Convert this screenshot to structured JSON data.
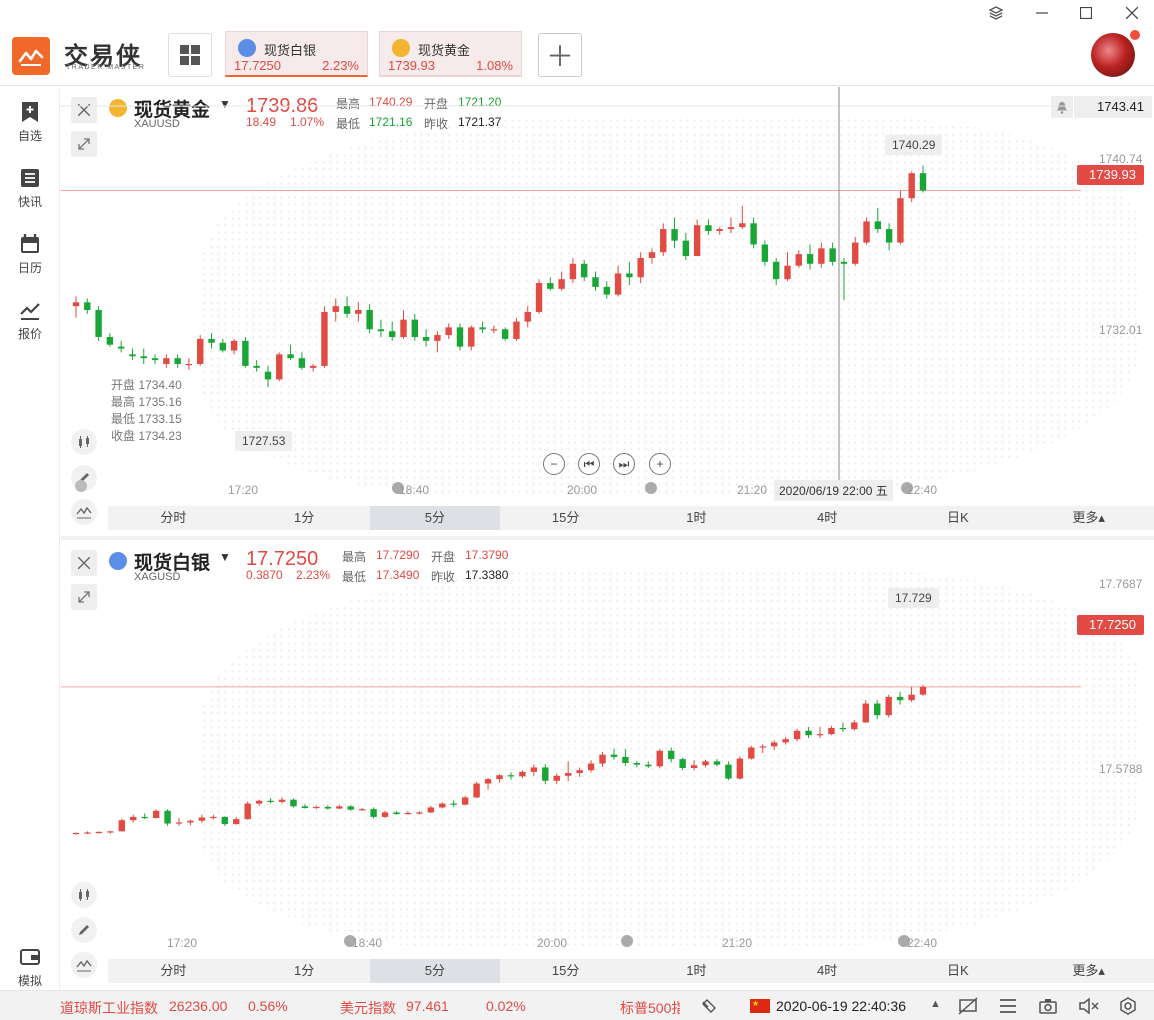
{
  "app": {
    "name": "交易侠",
    "subtitle": "TRADER MASTER"
  },
  "tickers": [
    {
      "name": "现货白银",
      "price": "17.7250",
      "change": "2.23%",
      "icon_color": "#5b8ee6"
    },
    {
      "name": "现货黄金",
      "price": "1739.93",
      "change": "1.08%",
      "icon_color": "#f2b431"
    }
  ],
  "sidebar": [
    {
      "label": "自选",
      "icon": "bookmark-plus-icon"
    },
    {
      "label": "快讯",
      "icon": "news-list-icon"
    },
    {
      "label": "日历",
      "icon": "calendar-icon"
    },
    {
      "label": "报价",
      "icon": "chart-line-icon"
    },
    {
      "label": "模拟",
      "icon": "wallet-icon"
    }
  ],
  "gold": {
    "name": "现货黄金",
    "code": "XAUUSD",
    "price": "1739.86",
    "change": "18.49",
    "pct": "1.07%",
    "high_label": "最高",
    "high": "1740.29",
    "open_label": "开盘",
    "open": "1721.20",
    "low_label": "最低",
    "low": "1721.16",
    "prev_label": "昨收",
    "prev": "1721.37",
    "alert_price": "1743.41",
    "current_tag": "1739.93",
    "peak_tip": "1740.29",
    "low_tip": "1727.53",
    "y_ticks": [
      "1740.74",
      "1732.01"
    ],
    "x_ticks": [
      "17:20",
      "18:40",
      "20:00",
      "21:20",
      "22:40"
    ],
    "crosshair_time": "2020/06/19 22:00 五",
    "ohlc": {
      "o_label": "开盘",
      "o": "1734.40",
      "h_label": "最高",
      "h": "1735.16",
      "l_label": "最低",
      "l": "1733.15",
      "c_label": "收盘",
      "c": "1734.23"
    }
  },
  "silver": {
    "name": "现货白银",
    "code": "XAGUSD",
    "price": "17.7250",
    "change": "0.3870",
    "pct": "2.23%",
    "high_label": "最高",
    "high": "17.7290",
    "open_label": "开盘",
    "open": "17.3790",
    "low_label": "最低",
    "low": "17.3490",
    "prev_label": "昨收",
    "prev": "17.3380",
    "current_tag": "17.7250",
    "peak_tip": "17.729",
    "y_ticks": [
      "17.7687",
      "17.5788"
    ],
    "x_ticks": [
      "17:20",
      "18:40",
      "20:00",
      "21:20",
      "22:40"
    ]
  },
  "timeframes": [
    "分时",
    "1分",
    "5分",
    "15分",
    "1时",
    "4时",
    "日K",
    "更多▴"
  ],
  "selected_timeframe": "5分",
  "status": {
    "dow_name": "道琼斯工业指数",
    "dow_val": "26236.00",
    "dow_pct": "0.56%",
    "usd_name": "美元指数",
    "usd_val": "97.461",
    "usd_pct": "0.02%",
    "sp_name": "标普500指",
    "datetime": "2020-06-19 22:40:36"
  },
  "colors": {
    "up": "#e24a44",
    "down": "#1aa537",
    "accent": "#f0682a"
  },
  "chart_data": [
    {
      "type": "candlestick",
      "title": "现货黄金 XAUUSD",
      "x_ticks": [
        "17:20",
        "18:40",
        "20:00",
        "21:20",
        "22:40"
      ],
      "candles": [
        [
          1733.0,
          1733.5,
          1732.4,
          1733.2
        ],
        [
          1733.2,
          1733.4,
          1732.6,
          1732.8
        ],
        [
          1732.8,
          1733.0,
          1731.2,
          1731.4
        ],
        [
          1731.4,
          1731.6,
          1730.9,
          1731.0
        ],
        [
          1730.9,
          1731.2,
          1730.6,
          1730.8
        ],
        [
          1730.5,
          1730.8,
          1730.2,
          1730.4
        ],
        [
          1730.4,
          1730.8,
          1730.0,
          1730.3
        ],
        [
          1730.3,
          1730.5,
          1730.0,
          1730.2
        ],
        [
          1730.0,
          1730.5,
          1729.8,
          1730.3
        ],
        [
          1730.3,
          1730.5,
          1729.8,
          1730.0
        ],
        [
          1730.0,
          1730.3,
          1729.7,
          1730.0
        ],
        [
          1730.0,
          1731.5,
          1729.9,
          1731.3
        ],
        [
          1731.3,
          1731.6,
          1730.8,
          1731.1
        ],
        [
          1731.1,
          1731.3,
          1730.6,
          1730.7
        ],
        [
          1730.7,
          1731.3,
          1730.5,
          1731.2
        ],
        [
          1731.2,
          1731.4,
          1729.8,
          1729.9
        ],
        [
          1729.9,
          1730.2,
          1729.6,
          1729.8
        ],
        [
          1729.6,
          1729.9,
          1728.8,
          1729.2
        ],
        [
          1729.2,
          1730.6,
          1729.1,
          1730.5
        ],
        [
          1730.5,
          1731.0,
          1730.2,
          1730.3
        ],
        [
          1730.3,
          1730.6,
          1729.7,
          1729.8
        ],
        [
          1729.8,
          1730.0,
          1729.6,
          1729.9
        ],
        [
          1729.9,
          1733.0,
          1729.8,
          1732.7
        ],
        [
          1732.7,
          1733.4,
          1732.2,
          1733.0
        ],
        [
          1733.0,
          1733.5,
          1732.4,
          1732.6
        ],
        [
          1732.6,
          1733.2,
          1732.2,
          1732.8
        ],
        [
          1732.8,
          1733.1,
          1731.6,
          1731.8
        ],
        [
          1731.8,
          1732.3,
          1731.4,
          1731.7
        ],
        [
          1731.7,
          1732.2,
          1731.2,
          1731.4
        ],
        [
          1731.4,
          1732.8,
          1731.3,
          1732.3
        ],
        [
          1732.3,
          1732.6,
          1731.2,
          1731.4
        ],
        [
          1731.4,
          1731.8,
          1730.9,
          1731.2
        ],
        [
          1731.2,
          1731.7,
          1730.6,
          1731.5
        ],
        [
          1731.5,
          1732.1,
          1731.3,
          1731.9
        ],
        [
          1731.9,
          1732.1,
          1730.7,
          1730.9
        ],
        [
          1730.9,
          1732.0,
          1730.7,
          1731.9
        ],
        [
          1731.9,
          1732.2,
          1731.6,
          1731.8
        ],
        [
          1731.8,
          1732.0,
          1731.6,
          1731.8
        ],
        [
          1731.8,
          1731.9,
          1731.2,
          1731.3
        ],
        [
          1731.3,
          1732.4,
          1731.2,
          1732.2
        ],
        [
          1732.2,
          1733.0,
          1731.9,
          1732.7
        ],
        [
          1732.7,
          1734.4,
          1732.6,
          1734.2
        ],
        [
          1734.2,
          1734.5,
          1733.8,
          1733.9
        ],
        [
          1733.9,
          1734.8,
          1733.8,
          1734.4
        ],
        [
          1734.4,
          1735.5,
          1734.2,
          1735.2
        ],
        [
          1735.2,
          1735.4,
          1734.3,
          1734.5
        ],
        [
          1734.5,
          1734.8,
          1733.8,
          1734.0
        ],
        [
          1734.0,
          1734.3,
          1733.4,
          1733.6
        ],
        [
          1733.6,
          1735.1,
          1733.5,
          1734.7
        ],
        [
          1734.7,
          1735.3,
          1734.1,
          1734.5
        ],
        [
          1734.5,
          1735.8,
          1734.2,
          1735.5
        ],
        [
          1735.5,
          1736.0,
          1735.2,
          1735.8
        ],
        [
          1735.8,
          1737.3,
          1735.6,
          1737.0
        ],
        [
          1737.0,
          1737.6,
          1736.0,
          1736.4
        ],
        [
          1736.4,
          1736.8,
          1735.4,
          1735.6
        ],
        [
          1735.6,
          1737.5,
          1735.6,
          1737.2
        ],
        [
          1737.2,
          1737.5,
          1736.7,
          1736.9
        ],
        [
          1736.9,
          1737.1,
          1736.7,
          1737.0
        ],
        [
          1737.0,
          1737.6,
          1736.8,
          1737.1
        ],
        [
          1737.1,
          1738.2,
          1737.0,
          1737.3
        ],
        [
          1737.3,
          1737.6,
          1736.0,
          1736.2
        ],
        [
          1736.2,
          1736.4,
          1735.1,
          1735.3
        ],
        [
          1735.3,
          1735.5,
          1734.1,
          1734.4
        ],
        [
          1734.4,
          1735.8,
          1734.3,
          1735.1
        ],
        [
          1735.1,
          1735.9,
          1735.0,
          1735.7
        ],
        [
          1735.7,
          1736.2,
          1734.9,
          1735.2
        ],
        [
          1735.2,
          1736.3,
          1735.0,
          1736.0
        ],
        [
          1736.0,
          1736.3,
          1735.1,
          1735.3
        ],
        [
          1735.3,
          1735.5,
          1733.3,
          1735.2
        ],
        [
          1735.2,
          1736.6,
          1735.1,
          1736.3
        ],
        [
          1736.3,
          1737.6,
          1736.2,
          1737.4
        ],
        [
          1737.4,
          1738.1,
          1736.8,
          1737.0
        ],
        [
          1737.0,
          1737.3,
          1735.9,
          1736.3
        ],
        [
          1736.3,
          1739.0,
          1736.2,
          1738.6
        ],
        [
          1738.6,
          1740.0,
          1738.4,
          1739.9
        ],
        [
          1739.9,
          1740.3,
          1738.9,
          1739.0
        ]
      ]
    },
    {
      "type": "candlestick",
      "title": "现货白银 XAGUSD",
      "x_ticks": [
        "17:20",
        "18:40",
        "20:00",
        "21:20",
        "22:40"
      ],
      "candles": [
        [
          17.347,
          17.35,
          17.346,
          17.349
        ],
        [
          17.349,
          17.352,
          17.347,
          17.35
        ],
        [
          17.35,
          17.352,
          17.348,
          17.351
        ],
        [
          17.351,
          17.353,
          17.348,
          17.352
        ],
        [
          17.352,
          17.375,
          17.352,
          17.372
        ],
        [
          17.372,
          17.382,
          17.368,
          17.378
        ],
        [
          17.378,
          17.384,
          17.374,
          17.376
        ],
        [
          17.376,
          17.392,
          17.375,
          17.389
        ],
        [
          17.389,
          17.392,
          17.362,
          17.366
        ],
        [
          17.366,
          17.376,
          17.362,
          17.368
        ],
        [
          17.368,
          17.373,
          17.363,
          17.371
        ],
        [
          17.371,
          17.382,
          17.367,
          17.377
        ],
        [
          17.377,
          17.382,
          17.373,
          17.378
        ],
        [
          17.378,
          17.379,
          17.362,
          17.365
        ],
        [
          17.365,
          17.378,
          17.364,
          17.374
        ],
        [
          17.374,
          17.406,
          17.373,
          17.402
        ],
        [
          17.402,
          17.409,
          17.398,
          17.407
        ],
        [
          17.407,
          17.412,
          17.402,
          17.405
        ],
        [
          17.405,
          17.413,
          17.402,
          17.409
        ],
        [
          17.409,
          17.411,
          17.395,
          17.397
        ],
        [
          17.397,
          17.401,
          17.393,
          17.394
        ],
        [
          17.394,
          17.398,
          17.392,
          17.396
        ],
        [
          17.396,
          17.399,
          17.391,
          17.393
        ],
        [
          17.393,
          17.4,
          17.392,
          17.397
        ],
        [
          17.397,
          17.399,
          17.389,
          17.391
        ],
        [
          17.391,
          17.394,
          17.389,
          17.392
        ],
        [
          17.392,
          17.395,
          17.375,
          17.378
        ],
        [
          17.378,
          17.389,
          17.376,
          17.386
        ],
        [
          17.386,
          17.388,
          17.382,
          17.383
        ],
        [
          17.383,
          17.388,
          17.382,
          17.385
        ],
        [
          17.385,
          17.388,
          17.382,
          17.386
        ],
        [
          17.386,
          17.398,
          17.385,
          17.395
        ],
        [
          17.395,
          17.404,
          17.393,
          17.402
        ],
        [
          17.402,
          17.408,
          17.396,
          17.4
        ],
        [
          17.4,
          17.416,
          17.399,
          17.413
        ],
        [
          17.413,
          17.441,
          17.412,
          17.438
        ],
        [
          17.438,
          17.448,
          17.427,
          17.446
        ],
        [
          17.446,
          17.455,
          17.44,
          17.453
        ],
        [
          17.453,
          17.458,
          17.445,
          17.451
        ],
        [
          17.451,
          17.462,
          17.448,
          17.459
        ],
        [
          17.459,
          17.472,
          17.452,
          17.467
        ],
        [
          17.467,
          17.473,
          17.437,
          17.443
        ],
        [
          17.443,
          17.456,
          17.437,
          17.452
        ],
        [
          17.452,
          17.478,
          17.442,
          17.457
        ],
        [
          17.457,
          17.467,
          17.45,
          17.462
        ],
        [
          17.462,
          17.48,
          17.458,
          17.474
        ],
        [
          17.474,
          17.495,
          17.468,
          17.49
        ],
        [
          17.49,
          17.501,
          17.481,
          17.486
        ],
        [
          17.486,
          17.5,
          17.47,
          17.475
        ],
        [
          17.475,
          17.478,
          17.467,
          17.472
        ],
        [
          17.472,
          17.478,
          17.466,
          17.469
        ],
        [
          17.469,
          17.5,
          17.466,
          17.497
        ],
        [
          17.497,
          17.503,
          17.476,
          17.482
        ],
        [
          17.482,
          17.485,
          17.462,
          17.466
        ],
        [
          17.466,
          17.48,
          17.462,
          17.471
        ],
        [
          17.471,
          17.481,
          17.467,
          17.478
        ],
        [
          17.478,
          17.482,
          17.469,
          17.472
        ],
        [
          17.472,
          17.478,
          17.444,
          17.447
        ],
        [
          17.447,
          17.487,
          17.445,
          17.483
        ],
        [
          17.483,
          17.506,
          17.481,
          17.503
        ],
        [
          17.503,
          17.509,
          17.493,
          17.505
        ],
        [
          17.505,
          17.516,
          17.498,
          17.512
        ],
        [
          17.512,
          17.522,
          17.508,
          17.518
        ],
        [
          17.518,
          17.537,
          17.514,
          17.533
        ],
        [
          17.533,
          17.54,
          17.52,
          17.525
        ],
        [
          17.525,
          17.54,
          17.52,
          17.527
        ],
        [
          17.527,
          17.542,
          17.525,
          17.538
        ],
        [
          17.538,
          17.548,
          17.531,
          17.536
        ],
        [
          17.536,
          17.552,
          17.533,
          17.548
        ],
        [
          17.548,
          17.588,
          17.547,
          17.582
        ],
        [
          17.582,
          17.588,
          17.554,
          17.561
        ],
        [
          17.561,
          17.598,
          17.557,
          17.594
        ],
        [
          17.594,
          17.603,
          17.58,
          17.588
        ],
        [
          17.588,
          17.612,
          17.585,
          17.598
        ],
        [
          17.598,
          17.616,
          17.596,
          17.612
        ]
      ]
    }
  ]
}
